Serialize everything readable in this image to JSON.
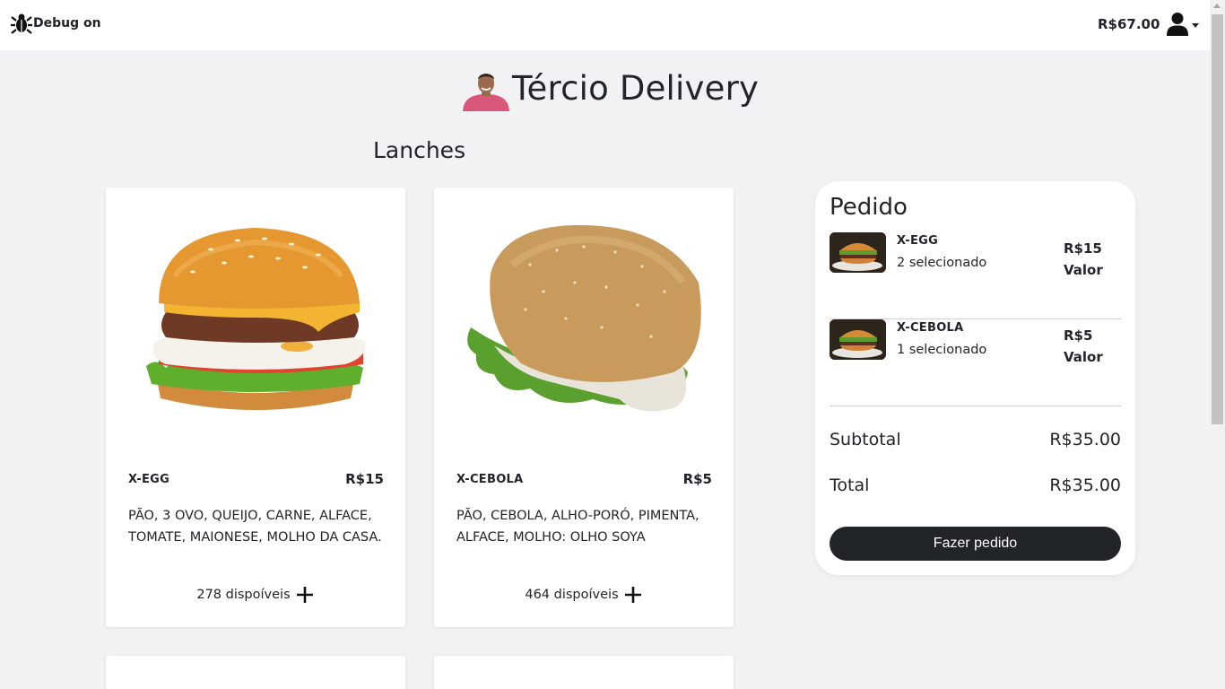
{
  "nav": {
    "debug_label": "Debug on",
    "wallet": "R$67.00"
  },
  "header": {
    "title": "Tércio Delivery"
  },
  "section": {
    "title": "Lanches"
  },
  "products": [
    {
      "name": "X-EGG",
      "price": "R$15",
      "description": "PÃO, 3 OVO, QUEIJO, CARNE, ALFACE, TOMATE, MAIONESE, MOLHO DA CASA.",
      "stock": "278 dispoíveis"
    },
    {
      "name": "X-CEBOLA",
      "price": "R$5",
      "description": "PÃO, CEBOLA, ALHO-PORÓ, PIMENTA, ALFACE, MOLHO: OLHO SOYA",
      "stock": "464 dispoíveis"
    }
  ],
  "order": {
    "title": "Pedido",
    "items": [
      {
        "name": "X-EGG",
        "quantity": "2 selecionado",
        "price": "R$15",
        "price_label": "Valor"
      },
      {
        "name": "X-CEBOLA",
        "quantity": "1 selecionado",
        "price": "R$5",
        "price_label": "Valor"
      }
    ],
    "subtotal_label": "Subtotal",
    "subtotal_value": "R$35.00",
    "total_label": "Total",
    "total_value": "R$35.00",
    "checkout_label": "Fazer pedido"
  },
  "icons": {
    "debug": "bug-icon",
    "user": "user-icon",
    "add": "plus-icon"
  }
}
